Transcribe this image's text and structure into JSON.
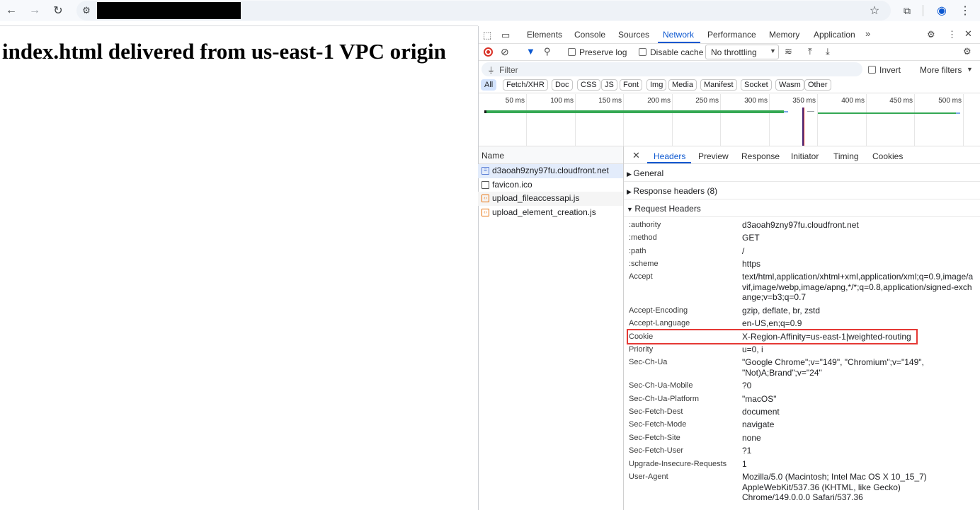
{
  "page": {
    "heading": "index.html delivered from us-east-1 VPC origin"
  },
  "colors": {
    "accent": "#0b57d0",
    "record_red": "#d93025",
    "highlight_box": "#e53935",
    "waterfall_green": "#34a853"
  },
  "devtools": {
    "tabs": [
      "Elements",
      "Console",
      "Sources",
      "Network",
      "Performance",
      "Memory",
      "Application"
    ],
    "active_tab": "Network",
    "toolbar": {
      "preserve_log": "Preserve log",
      "disable_cache": "Disable cache",
      "throttling": "No throttling"
    },
    "filter": {
      "placeholder": "Filter",
      "invert": "Invert",
      "more_filters": "More filters"
    },
    "type_chips": [
      "All",
      "Fetch/XHR",
      "Doc",
      "CSS",
      "JS",
      "Font",
      "Img",
      "Media",
      "Manifest",
      "Socket",
      "Wasm",
      "Other"
    ],
    "timeline_ticks": [
      "50 ms",
      "100 ms",
      "150 ms",
      "200 ms",
      "250 ms",
      "300 ms",
      "350 ms",
      "400 ms",
      "450 ms",
      "500 ms"
    ],
    "requests": {
      "header": "Name",
      "items": [
        {
          "name": "d3aoah9zny97fu.cloudfront.net",
          "icon": "document-icon",
          "selected": true
        },
        {
          "name": "favicon.ico",
          "icon": "file-icon",
          "selected": false
        },
        {
          "name": "upload_fileaccessapi.js",
          "icon": "script-icon",
          "selected": false
        },
        {
          "name": "upload_element_creation.js",
          "icon": "script-icon",
          "selected": false
        }
      ]
    },
    "detail_tabs": [
      "Headers",
      "Preview",
      "Response",
      "Initiator",
      "Timing",
      "Cookies"
    ],
    "active_detail_tab": "Headers",
    "sections": {
      "general": "General",
      "response_headers": "Response headers (8)",
      "request_headers": "Request Headers"
    },
    "request_headers": [
      {
        "key": ":authority",
        "value": "d3aoah9zny97fu.cloudfront.net"
      },
      {
        "key": ":method",
        "value": "GET"
      },
      {
        "key": ":path",
        "value": "/"
      },
      {
        "key": ":scheme",
        "value": "https"
      },
      {
        "key": "Accept",
        "value": "text/html,application/xhtml+xml,application/xml;q=0.9,image/avif,image/webp,image/apng,*/*;q=0.8,application/signed-exchange;v=b3;q=0.7"
      },
      {
        "key": "Accept-Encoding",
        "value": "gzip, deflate, br, zstd"
      },
      {
        "key": "Accept-Language",
        "value": "en-US,en;q=0.9"
      },
      {
        "key": "Cookie",
        "value": "X-Region-Affinity=us-east-1|weighted-routing"
      },
      {
        "key": "Priority",
        "value": "u=0, i"
      },
      {
        "key": "Sec-Ch-Ua",
        "value": "\"Google Chrome\";v=\"149\", \"Chromium\";v=\"149\", \"Not)A;Brand\";v=\"24\""
      },
      {
        "key": "Sec-Ch-Ua-Mobile",
        "value": "?0"
      },
      {
        "key": "Sec-Ch-Ua-Platform",
        "value": "\"macOS\""
      },
      {
        "key": "Sec-Fetch-Dest",
        "value": "document"
      },
      {
        "key": "Sec-Fetch-Mode",
        "value": "navigate"
      },
      {
        "key": "Sec-Fetch-Site",
        "value": "none"
      },
      {
        "key": "Sec-Fetch-User",
        "value": "?1"
      },
      {
        "key": "Upgrade-Insecure-Requests",
        "value": "1"
      },
      {
        "key": "User-Agent",
        "value": "Mozilla/5.0 (Macintosh; Intel Mac OS X 10_15_7) AppleWebKit/537.36 (KHTML, like Gecko) Chrome/149.0.0.0 Safari/537.36"
      }
    ]
  }
}
